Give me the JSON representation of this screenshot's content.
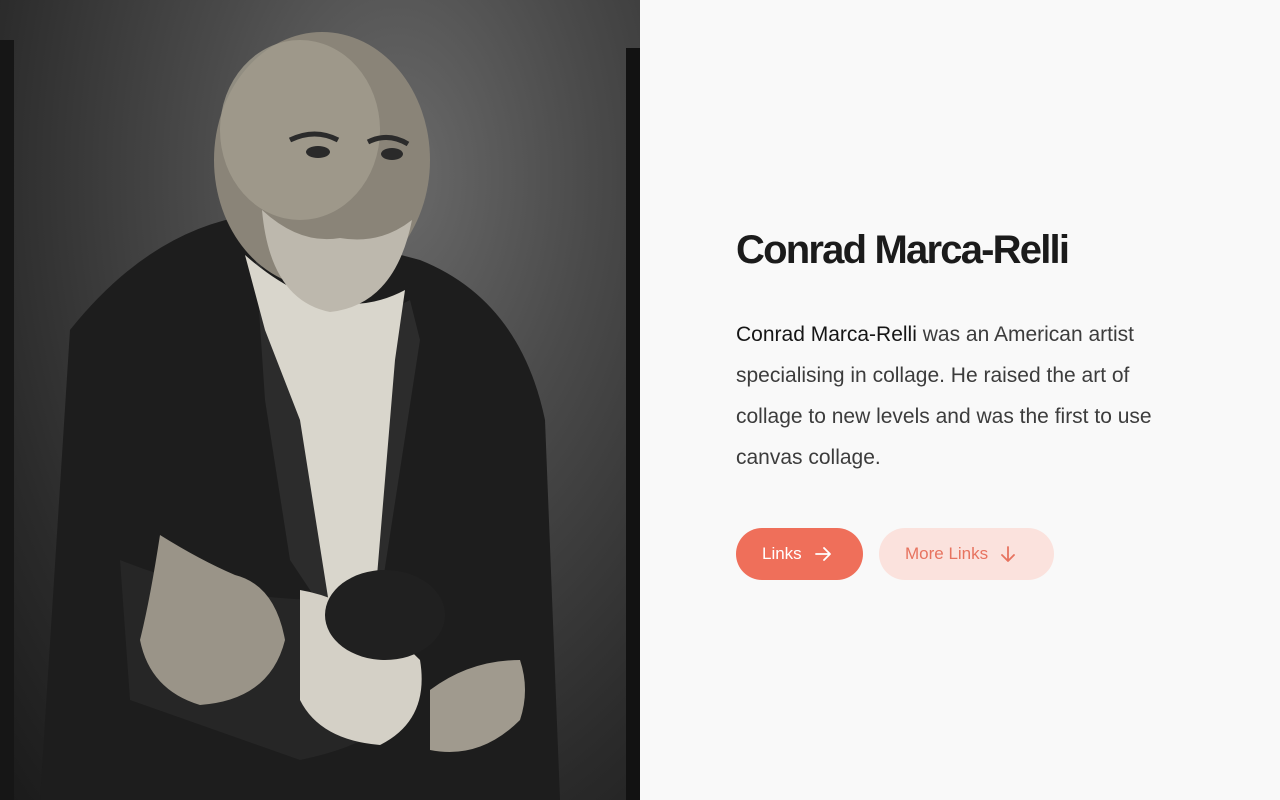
{
  "portrait": {
    "icon": "portrait-photo"
  },
  "profile": {
    "title": "Conrad Marca-Relli",
    "bio_name": "Conrad Marca-Relli",
    "bio_rest": " was an American artist specialising in collage. He raised the art of collage to new levels and was the first to use canvas collage."
  },
  "actions": {
    "links_label": "Links",
    "links_icon": "arrow-right-icon",
    "more_links_label": "More Links",
    "more_links_icon": "arrow-down-icon"
  },
  "colors": {
    "accent": "#ef6f5a",
    "accent_soft": "#fbe2dd",
    "accent_text": "#e7735f",
    "background": "#f9f9f9"
  }
}
